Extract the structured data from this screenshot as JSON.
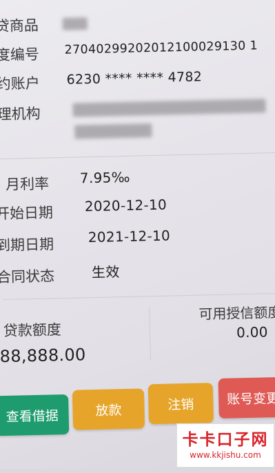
{
  "details": {
    "product_label": "贷商品",
    "contract_no_label": "度编号",
    "contract_no": "27040299202012100029130 1",
    "account_label": "约账户",
    "account_value": "6230 **** **** 4782",
    "org_label": "理机构",
    "monthly_rate_label": "月利率",
    "monthly_rate": "7.95‰",
    "start_date_label": "开始日期",
    "start_date": "2020-12-10",
    "end_date_label": "到期日期",
    "end_date": "2021-12-10",
    "status_label": "合同状态",
    "status_value": "生效"
  },
  "amounts": {
    "loan_amount_label": "贷款额度",
    "loan_amount": "88,888.00",
    "available_label": "可用授信额度",
    "available_value": "0.00"
  },
  "actions": {
    "view_receipt": "查看借据",
    "disburse": "放款",
    "cancel": "注销",
    "account_change": "账号变更"
  },
  "watermark": {
    "title": "卡卡口子网",
    "url": "www.kkjishu.com"
  },
  "colors": {
    "green": "#1e9c6e",
    "orange": "#e6a52a",
    "red": "#df5a55",
    "brand_red": "#d8232a"
  }
}
